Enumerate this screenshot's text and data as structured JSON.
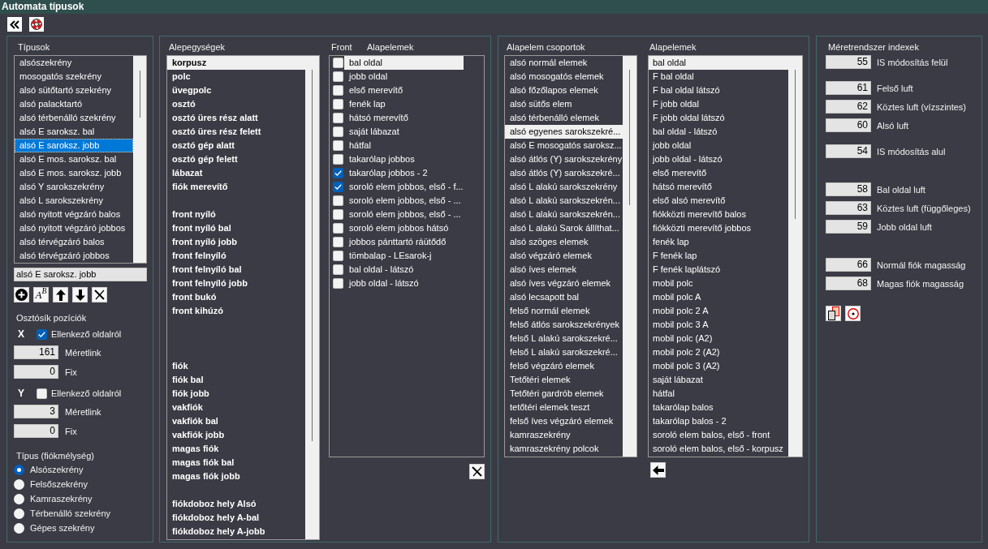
{
  "window": {
    "title": "Automata típusok"
  },
  "types_panel": {
    "title": "Típusok",
    "items": [
      {
        "label": "alsószekrény",
        "selected": false
      },
      {
        "label": "mosogatós szekrény",
        "selected": false
      },
      {
        "label": "alsó sütőtartó szekrény",
        "selected": false
      },
      {
        "label": "alsó palacktartó",
        "selected": false
      },
      {
        "label": "alsó térbenálló szekrény",
        "selected": false
      },
      {
        "label": "alsó E saroksz. bal",
        "selected": false
      },
      {
        "label": "alsó E saroksz. jobb",
        "selected": true
      },
      {
        "label": "alsó E mos. saroksz. bal",
        "selected": false
      },
      {
        "label": "alsó E mos. saroksz. jobb",
        "selected": false
      },
      {
        "label": "alsó Y sarokszekrény",
        "selected": false
      },
      {
        "label": "alsó L sarokszekrény",
        "selected": false
      },
      {
        "label": "alsó nyitott végzáró balos",
        "selected": false
      },
      {
        "label": "alsó nyitott végzáró jobbos",
        "selected": false
      },
      {
        "label": "alsó térvégzáró balos",
        "selected": false
      },
      {
        "label": "alsó térvégzáró jobbos",
        "selected": false
      }
    ],
    "name_field": {
      "value": "alsó E saroksz. jobb"
    },
    "rename_button": {
      "label": "A$^{B}$"
    },
    "divider_positions": {
      "title": "Osztósík pozíciók",
      "axes": [
        {
          "axis": "X",
          "checkbox": {
            "label": "Ellenkező oldalról",
            "checked": true
          },
          "fields": [
            {
              "value": "161",
              "label": "Méretlink"
            },
            {
              "value": "0",
              "label": "Fix"
            }
          ]
        },
        {
          "axis": "Y",
          "checkbox": {
            "label": "Ellenkező oldalról",
            "checked": false
          },
          "fields": [
            {
              "value": "3",
              "label": "Méretlink"
            },
            {
              "value": "0",
              "label": "Fix"
            }
          ]
        }
      ]
    },
    "depth_type": {
      "title": "Típus (fiókmélység)",
      "options": [
        {
          "label": "Alsószekrény",
          "selected": true
        },
        {
          "label": "Felsőszekrény",
          "selected": false
        },
        {
          "label": "Kamraszekrény",
          "selected": false
        },
        {
          "label": "Térbenálló szekrény",
          "selected": false
        },
        {
          "label": "Gépes szekrény",
          "selected": false
        }
      ]
    }
  },
  "subunits_panel": {
    "title": "Alepegységek",
    "items": [
      {
        "kind": "entry",
        "label": "korpusz",
        "selected": true
      },
      {
        "kind": "entry",
        "label": "polc",
        "selected": false
      },
      {
        "kind": "entry",
        "label": "üvegpolc",
        "selected": false
      },
      {
        "kind": "entry",
        "label": "osztó",
        "selected": false
      },
      {
        "kind": "entry",
        "label": "osztó üres rész alatt",
        "selected": false
      },
      {
        "kind": "entry",
        "label": "osztó üres rész felett",
        "selected": false
      },
      {
        "kind": "entry",
        "label": "osztó gép alatt",
        "selected": false
      },
      {
        "kind": "entry",
        "label": "osztó gép felett",
        "selected": false
      },
      {
        "kind": "entry",
        "label": "lábazat",
        "selected": false
      },
      {
        "kind": "entry",
        "label": "fiók merevítő",
        "selected": false
      },
      {
        "kind": "gap",
        "selected": false
      },
      {
        "kind": "entry",
        "label": "front nyíló",
        "selected": false
      },
      {
        "kind": "entry",
        "label": "front nyíló bal",
        "selected": false
      },
      {
        "kind": "entry",
        "label": "front nyíló jobb",
        "selected": false
      },
      {
        "kind": "entry",
        "label": "front felnyíló",
        "selected": false
      },
      {
        "kind": "entry",
        "label": "front felnyíló bal",
        "selected": false
      },
      {
        "kind": "entry",
        "label": "front felnyíló jobb",
        "selected": false
      },
      {
        "kind": "entry",
        "label": "front bukó",
        "selected": false
      },
      {
        "kind": "entry",
        "label": "front kihúzó",
        "selected": false
      },
      {
        "kind": "gap",
        "selected": false
      },
      {
        "kind": "gap",
        "selected": false
      },
      {
        "kind": "gap",
        "selected": false
      },
      {
        "kind": "entry",
        "label": "fiók",
        "selected": false
      },
      {
        "kind": "entry",
        "label": "fiók bal",
        "selected": false
      },
      {
        "kind": "entry",
        "label": "fiók jobb",
        "selected": false
      },
      {
        "kind": "entry",
        "label": "vakfiók",
        "selected": false
      },
      {
        "kind": "entry",
        "label": "vakfiók bal",
        "selected": false
      },
      {
        "kind": "entry",
        "label": "vakfiók jobb",
        "selected": false
      },
      {
        "kind": "entry",
        "label": "magas fiók",
        "selected": false
      },
      {
        "kind": "entry",
        "label": "magas fiók bal",
        "selected": false
      },
      {
        "kind": "entry",
        "label": "magas fiók jobb",
        "selected": false
      },
      {
        "kind": "gap",
        "selected": false
      },
      {
        "kind": "entry",
        "label": "fiókdoboz hely Alsó",
        "selected": false
      },
      {
        "kind": "entry",
        "label": "fiókdoboz hely A-bal",
        "selected": false
      },
      {
        "kind": "entry",
        "label": "fiókdoboz hely A-jobb",
        "selected": false
      }
    ],
    "elements": {
      "front_header": "Front",
      "header": "Alapelemek",
      "rows": [
        {
          "label": "bal oldal",
          "front": false,
          "selected": true
        },
        {
          "label": "jobb oldal",
          "front": false,
          "selected": false
        },
        {
          "label": "első merevítő",
          "front": false,
          "selected": false
        },
        {
          "label": "fenék lap",
          "front": false,
          "selected": false
        },
        {
          "label": "hátsó merevítő",
          "front": false,
          "selected": false
        },
        {
          "label": "saját lábazat",
          "front": false,
          "selected": false
        },
        {
          "label": "hátfal",
          "front": false,
          "selected": false
        },
        {
          "label": "takarólap jobbos",
          "front": false,
          "selected": false
        },
        {
          "label": "takarólap jobbos - 2",
          "front": true,
          "selected": false
        },
        {
          "label": "soroló elem jobbos, első - f...",
          "front": true,
          "selected": false
        },
        {
          "label": "soroló elem jobbos, első - ...",
          "front": false,
          "selected": false
        },
        {
          "label": "soroló elem jobbos, első - ...",
          "front": false,
          "selected": false
        },
        {
          "label": "soroló elem jobbos hátsó",
          "front": false,
          "selected": false
        },
        {
          "label": "jobbos pánttartó ráütődő",
          "front": false,
          "selected": false
        },
        {
          "label": "tömbalap - LEsarok-j",
          "front": false,
          "selected": false
        },
        {
          "label": "bal oldal - látszó",
          "front": false,
          "selected": false
        },
        {
          "label": "jobb oldal - látszó",
          "front": false,
          "selected": false
        }
      ]
    }
  },
  "groups_panel": {
    "groups_title": "Alapelem csoportok",
    "groups": [
      {
        "label": "alsó normál elemek",
        "selected": false
      },
      {
        "label": "alsó mosogatós elemek",
        "selected": false
      },
      {
        "label": "alsó főzőlapos elemek",
        "selected": false
      },
      {
        "label": "alsó sütős elem",
        "selected": false
      },
      {
        "label": "alsó térbenálló elemek",
        "selected": false
      },
      {
        "label": "alsó egyenes sarokszekré...",
        "selected": true
      },
      {
        "label": "alsó E mosogatós saroksz...",
        "selected": false
      },
      {
        "label": "alsó átlós (Y) sarokszekrény",
        "selected": false
      },
      {
        "label": "alsó átlós (Y) sarokszekré...",
        "selected": false
      },
      {
        "label": "alsó L alakú sarokszekrény",
        "selected": false
      },
      {
        "label": "alsó L alakú sarokszekrén...",
        "selected": false
      },
      {
        "label": "alsó L alakú sarokszekrén...",
        "selected": false
      },
      {
        "label": "alsó L alakú Sarok állíthat...",
        "selected": false
      },
      {
        "label": "alsó szöges elemek",
        "selected": false
      },
      {
        "label": "alsó végzáró elemek",
        "selected": false
      },
      {
        "label": "alsó íves elemek",
        "selected": false
      },
      {
        "label": "alsó íves végzáró elemek",
        "selected": false
      },
      {
        "label": "alsó lecsapott bal",
        "selected": false
      },
      {
        "label": "felső normál elemek",
        "selected": false
      },
      {
        "label": "felső átlós sarokszekrények",
        "selected": false
      },
      {
        "label": "felső L alakú sarokszekré...",
        "selected": false
      },
      {
        "label": "felső L alakú sarokszekré...",
        "selected": false
      },
      {
        "label": "felső végzáró elemek",
        "selected": false
      },
      {
        "label": "Tetőtéri elemek",
        "selected": false
      },
      {
        "label": "Tetőtéri gardrób elemek",
        "selected": false
      },
      {
        "label": "tetőtéri elemek teszt",
        "selected": false
      },
      {
        "label": "felső íves végzáró elemek",
        "selected": false
      },
      {
        "label": "kamraszekrény",
        "selected": false
      },
      {
        "label": "kamraszekrény polcok",
        "selected": false
      }
    ],
    "elements_title": "Alapelemek",
    "elements": [
      {
        "label": "bal oldal",
        "selected": true
      },
      {
        "label": "F bal oldal",
        "selected": false
      },
      {
        "label": "F bal oldal látszó",
        "selected": false
      },
      {
        "label": "F jobb oldal",
        "selected": false
      },
      {
        "label": "F jobb oldal látszó",
        "selected": false
      },
      {
        "label": "bal oldal - látszó",
        "selected": false
      },
      {
        "label": "jobb oldal",
        "selected": false
      },
      {
        "label": "jobb oldal - látszó",
        "selected": false
      },
      {
        "label": "első merevítő",
        "selected": false
      },
      {
        "label": "hátsó merevítő",
        "selected": false
      },
      {
        "label": "első alsó merevítő",
        "selected": false
      },
      {
        "label": "fiókközti merevítő balos",
        "selected": false
      },
      {
        "label": "fiókközti merevítő jobbos",
        "selected": false
      },
      {
        "label": "fenék lap",
        "selected": false
      },
      {
        "label": "F fenék lap",
        "selected": false
      },
      {
        "label": "F fenék laplátszó",
        "selected": false
      },
      {
        "label": "mobil polc",
        "selected": false
      },
      {
        "label": "mobil polc A",
        "selected": false
      },
      {
        "label": "mobil polc 2 A",
        "selected": false
      },
      {
        "label": "mobil polc 3 A",
        "selected": false
      },
      {
        "label": "mobil polc (A2)",
        "selected": false
      },
      {
        "label": "mobil polc 2 (A2)",
        "selected": false
      },
      {
        "label": "mobil polc 3 (A2)",
        "selected": false
      },
      {
        "label": "saját lábazat",
        "selected": false
      },
      {
        "label": "hátfal",
        "selected": false
      },
      {
        "label": "takarólap balos",
        "selected": false
      },
      {
        "label": "takarólap balos - 2",
        "selected": false
      },
      {
        "label": "soroló elem balos, első - front",
        "selected": false
      },
      {
        "label": "soroló elem balos, első - korpusz",
        "selected": false
      }
    ]
  },
  "size_indexes": {
    "title": "Méretrendszer indexek",
    "sections": [
      {
        "groups": [
          {
            "fields": [
              {
                "value": "55",
                "label": "IS módosítás felül"
              }
            ]
          },
          {
            "fields": [
              {
                "value": "61",
                "label": "Felső luft"
              },
              {
                "value": "62",
                "label": "Köztes luft (vízszintes)"
              },
              {
                "value": "60",
                "label": "Alsó luft"
              }
            ]
          },
          {
            "fields": [
              {
                "value": "54",
                "label": "IS módosítás alul"
              }
            ]
          }
        ]
      },
      {
        "groups": [
          {
            "fields": [
              {
                "value": "58",
                "label": "Bal oldal luft"
              },
              {
                "value": "63",
                "label": "Köztes luft (függőleges)"
              },
              {
                "value": "59",
                "label": "Jobb oldal luft"
              }
            ]
          }
        ]
      },
      {
        "groups": [
          {
            "fields": [
              {
                "value": "66",
                "label": "Normál fiók magasság"
              },
              {
                "value": "68",
                "label": "Magas fiók magasság"
              }
            ]
          }
        ]
      }
    ]
  }
}
